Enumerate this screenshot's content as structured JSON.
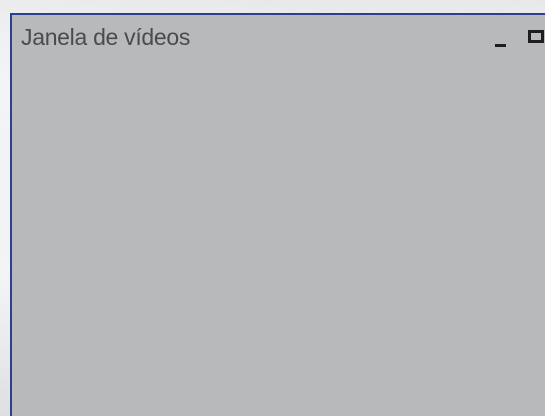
{
  "window": {
    "title": "Janela de vídeos",
    "controls": {
      "minimize_icon": "minimize-icon",
      "maximize_icon": "maximize-icon"
    },
    "colors": {
      "background": "#b8b9bb",
      "border": "#2f3f8f",
      "title_text": "#4a4b4e",
      "control_glyph": "#1e1e20"
    }
  }
}
